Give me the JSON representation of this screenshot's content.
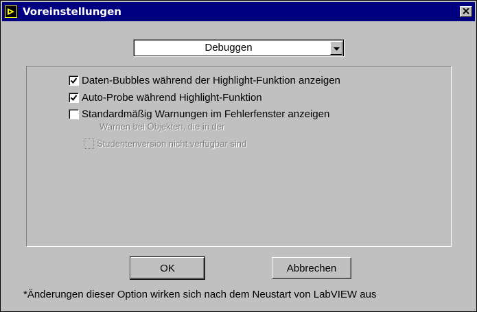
{
  "window": {
    "title": "Voreinstellungen",
    "icon": "labview-app-icon",
    "close_icon": "close-icon"
  },
  "category_select": {
    "selected": "Debuggen",
    "arrow_icon": "chevron-down-icon"
  },
  "options": [
    {
      "label": "Daten-Bubbles während der Highlight-Funktion anzeigen",
      "checked": true,
      "enabled": true
    },
    {
      "label": "Auto-Probe während Highlight-Funktion",
      "checked": true,
      "enabled": true
    },
    {
      "label": "Standardmäßig Warnungen im Fehlerfenster anzeigen",
      "checked": false,
      "enabled": true
    },
    {
      "label_line1": "Warnen bei Objekten, die in der",
      "label_line2": "Studentenversion nicht verfügbar sind",
      "checked": false,
      "enabled": false
    }
  ],
  "buttons": {
    "ok": "OK",
    "cancel": "Abbrechen"
  },
  "footnote": "*Änderungen dieser Option wirken sich nach dem Neustart von LabVIEW aus",
  "colors": {
    "titlebar": "#000080",
    "face": "#c0c0c0",
    "disabled_text": "#808080"
  }
}
